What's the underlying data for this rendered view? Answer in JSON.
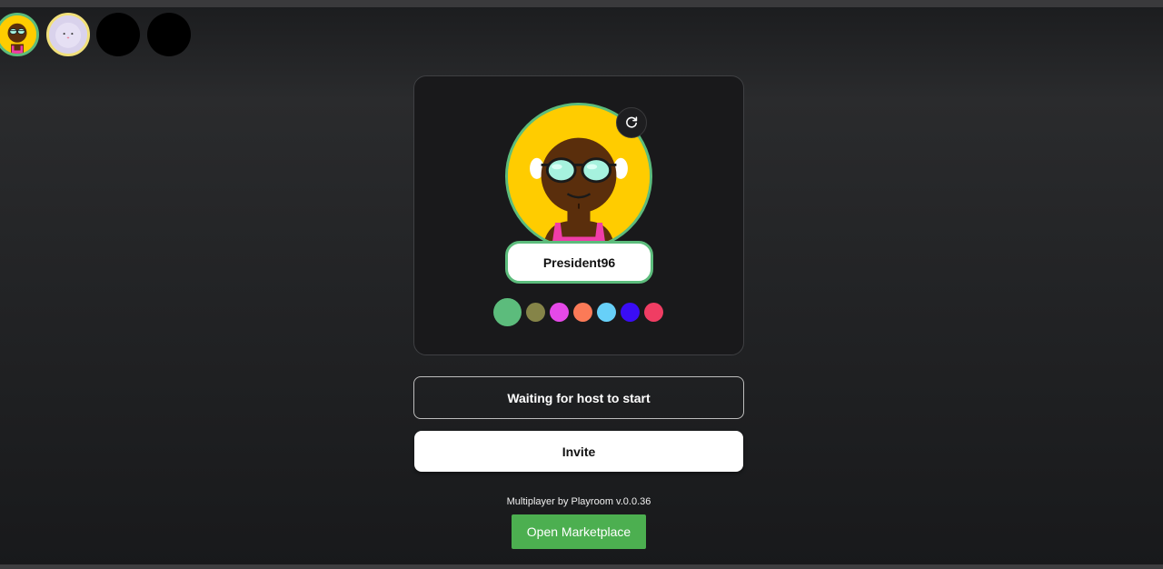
{
  "players": [
    {
      "slot": 1,
      "avatar": "sunglasses-face",
      "color": "#5cbc7c"
    },
    {
      "slot": 2,
      "avatar": "bunny-face",
      "color": "#f1e07a"
    },
    {
      "slot": 3,
      "avatar": "empty",
      "color": "#000000"
    },
    {
      "slot": 4,
      "avatar": "empty",
      "color": "#000000"
    }
  ],
  "profile": {
    "name": "President96",
    "selected_color": "#5cbc7c",
    "refresh_icon": "refresh-icon",
    "colors": [
      "#5cbc7c",
      "#858448",
      "#e549e8",
      "#fb7a57",
      "#67d0f8",
      "#3a0df5",
      "#f03d63"
    ]
  },
  "lobby": {
    "status_label": "Waiting for host to start",
    "invite_label": "Invite",
    "credit": "Multiplayer by Playroom v.0.0.36",
    "marketplace_label": "Open Marketplace"
  }
}
